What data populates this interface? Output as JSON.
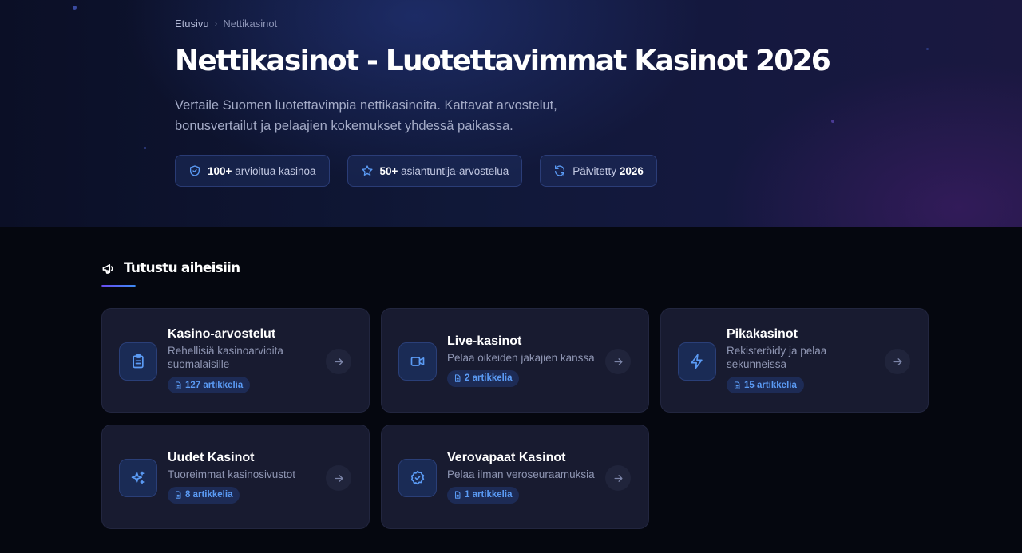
{
  "breadcrumb": {
    "home": "Etusivu",
    "separator": "›",
    "current": "Nettikasinot"
  },
  "hero": {
    "title": "Nettikasinot - Luotettavimmat Kasinot 2026",
    "subtitle_line1": "Vertaile Suomen luotettavimpia nettikasinoita. Kattavat arvostelut,",
    "subtitle_line2": "bonusvertailut ja pelaajien kokemukset yhdessä paikassa.",
    "stats": [
      {
        "icon": "shield-icon",
        "strong": "100+",
        "text": "arvioitua kasinoa"
      },
      {
        "icon": "star-icon",
        "strong": "50+",
        "text": "asiantuntija-arvostelua"
      },
      {
        "icon": "refresh-icon",
        "text": "Päivitetty",
        "strong": "2026"
      }
    ]
  },
  "section": {
    "icon": "megaphone-icon",
    "title": "Tutustu aiheisiin"
  },
  "cards": [
    {
      "icon": "clipboard-icon",
      "title": "Kasino-arvostelut",
      "description": "Rehellisiä kasinoarvioita suomalaisille",
      "count": "127 artikkelia"
    },
    {
      "icon": "video-icon",
      "title": "Live-kasinot",
      "description": "Pelaa oikeiden jakajien kanssa",
      "count": "2 artikkelia"
    },
    {
      "icon": "lightning-icon",
      "title": "Pikakasinot",
      "description": "Rekisteröidy ja pelaa sekunneissa",
      "count": "15 artikkelia"
    },
    {
      "icon": "sparkles-icon",
      "title": "Uudet Kasinot",
      "description": "Tuoreimmat kasinosivustot",
      "count": "8 artikkelia"
    },
    {
      "icon": "badge-check-icon",
      "title": "Verovapaat Kasinot",
      "description": "Pelaa ilman veroseuraamuksia",
      "count": "1 artikkelia"
    }
  ],
  "colors": {
    "accent": "#5b9bf5",
    "card_bg": "#181b30",
    "page_bg": "#05070f"
  }
}
